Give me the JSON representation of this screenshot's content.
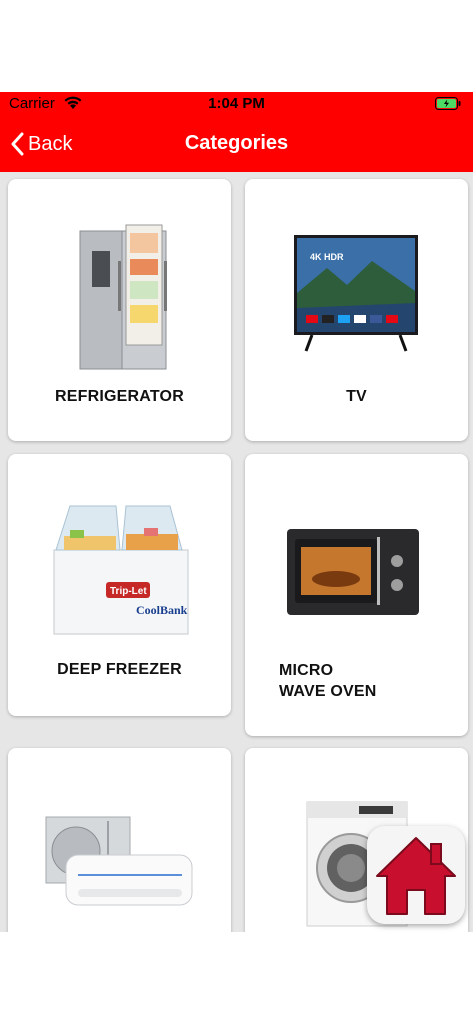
{
  "status_bar": {
    "carrier": "Carrier",
    "time": "1:04 PM"
  },
  "nav": {
    "back_label": "Back",
    "title": "Categories"
  },
  "categories": [
    {
      "label": "REFRIGERATOR",
      "icon": "refrigerator-image"
    },
    {
      "label": "TV",
      "icon": "tv-image"
    },
    {
      "label": "DEEP FREEZER",
      "icon": "deep-freezer-image"
    },
    {
      "label_line1": "MICRO",
      "label_line2": "WAVE OVEN",
      "icon": "microwave-oven-image"
    },
    {
      "label": "",
      "icon": "air-conditioner-image"
    },
    {
      "label": "",
      "icon": "washing-machine-image"
    }
  ],
  "tv_screen_text": "4K HDR",
  "freezer_brand": {
    "line1": "Trip-Let",
    "line2": "CoolBank"
  },
  "colors": {
    "accent": "#ff0000",
    "background": "#e6e6e6",
    "home_icon": "#c8102e"
  }
}
